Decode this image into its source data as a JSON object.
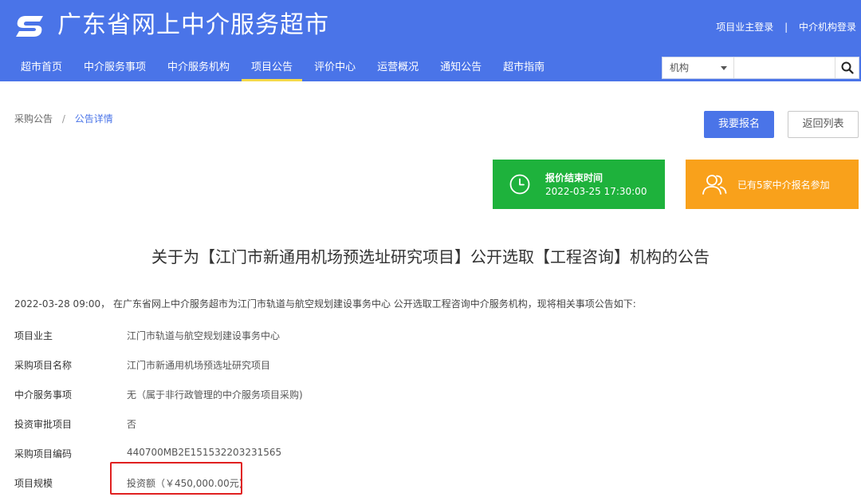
{
  "header": {
    "site_title": "广东省网上中介服务超市",
    "owner_login": "项目业主登录",
    "separator": "|",
    "agency_login": "中介机构登录",
    "color": "#4a74e8"
  },
  "nav": {
    "items": [
      {
        "label": "超市首页"
      },
      {
        "label": "中介服务事项"
      },
      {
        "label": "中介服务机构"
      },
      {
        "label": "项目公告",
        "active": true
      },
      {
        "label": "评价中心"
      },
      {
        "label": "运营概况"
      },
      {
        "label": "通知公告"
      },
      {
        "label": "超市指南"
      }
    ]
  },
  "search": {
    "select_value": "机构",
    "input_value": "",
    "button_icon": "search-icon"
  },
  "breadcrumb": {
    "parent": "采购公告",
    "separator": "/",
    "current": "公告详情"
  },
  "actions": {
    "signup_label": "我要报名",
    "back_label": "返回列表"
  },
  "cards": {
    "deadline_label": "报价结束时间",
    "deadline_value": "2022-03-25 17:30:00",
    "deadline_icon": "clock-icon",
    "deadline_color": "#1eb23c",
    "signup_count_text": "已有5家中介报名参加",
    "signup_icon": "users-icon",
    "signup_color": "#f9a11b"
  },
  "article": {
    "title": "关于为【江门市新通用机场预选址研究项目】公开选取【工程咨询】机构的公告",
    "intro": "2022-03-28 09:00， 在广东省网上中介服务超市为江门市轨道与航空规划建设事务中心 公开选取工程咨询中介服务机构，现将相关事项公告如下:",
    "fields": [
      {
        "key": "项目业主",
        "value": "江门市轨道与航空规划建设事务中心"
      },
      {
        "key": "采购项目名称",
        "value": "江门市新通用机场预选址研究项目"
      },
      {
        "key": "中介服务事项",
        "value": "无（属于非行政管理的中介服务项目采购)"
      },
      {
        "key": "投资审批项目",
        "value": "否"
      },
      {
        "key": "采购项目编码",
        "value": "440700MB2E151532203231565"
      },
      {
        "key": "项目规模",
        "value": "投资额（￥450,000.00元)"
      }
    ]
  },
  "highlight_color": "#e02020"
}
